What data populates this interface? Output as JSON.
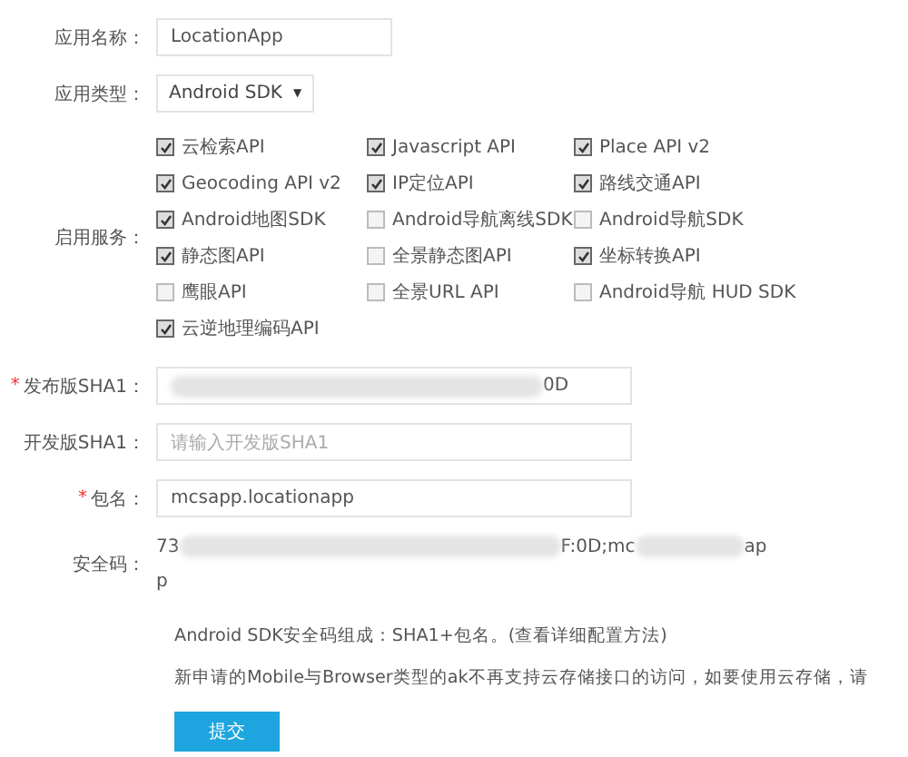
{
  "app_name": {
    "label": "应用名称：",
    "value": "LocationApp"
  },
  "app_type": {
    "label": "应用类型：",
    "value": "Android SDK",
    "caret": "▼"
  },
  "services": {
    "label": "启用服务：",
    "items": [
      {
        "label": "云检索API",
        "checked": true
      },
      {
        "label": "Javascript API",
        "checked": true
      },
      {
        "label": "Place API v2",
        "checked": true
      },
      {
        "label": "Geocoding API v2",
        "checked": true
      },
      {
        "label": "IP定位API",
        "checked": true
      },
      {
        "label": "路线交通API",
        "checked": true
      },
      {
        "label": "Android地图SDK",
        "checked": true
      },
      {
        "label": "Android导航离线SDK",
        "checked": false
      },
      {
        "label": "Android导航SDK",
        "checked": false
      },
      {
        "label": "静态图API",
        "checked": true
      },
      {
        "label": "全景静态图API",
        "checked": false
      },
      {
        "label": "坐标转换API",
        "checked": true
      },
      {
        "label": "鹰眼API",
        "checked": false
      },
      {
        "label": "全景URL API",
        "checked": false
      },
      {
        "label": "Android导航 HUD SDK",
        "checked": false
      },
      {
        "label": "云逆地理编码API",
        "checked": true
      }
    ]
  },
  "fields": [
    {
      "label": "发布版SHA1：",
      "required": true,
      "value_tail": "0D",
      "redacted": true
    },
    {
      "label": "开发版SHA1：",
      "required": false,
      "placeholder": "请输入开发版SHA1"
    },
    {
      "label": "包名：",
      "required": true,
      "value": "mcsapp.locationapp"
    }
  ],
  "required_mark": "*",
  "security_code": {
    "label": "安全码：",
    "parts": [
      "73",
      "F:0D;mc",
      "ap"
    ],
    "second_line": "p"
  },
  "notes": [
    "Android SDK安全码组成：SHA1+包名。(查看详细配置方法)",
    "新申请的Mobile与Browser类型的ak不再支持云存储接口的访问，如要使用云存储，请"
  ],
  "submit": "提交"
}
